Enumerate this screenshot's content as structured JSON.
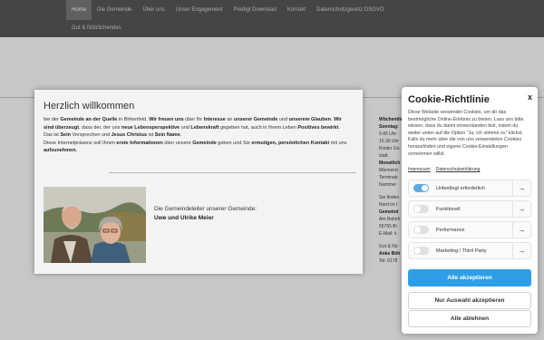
{
  "nav": {
    "items": [
      {
        "label": "Home",
        "active": true
      },
      {
        "label": "Die Gemeinde",
        "active": false
      },
      {
        "label": "Über uns",
        "active": false
      },
      {
        "label": "Unser Engagement",
        "active": false
      },
      {
        "label": "Predigt Download",
        "active": false
      },
      {
        "label": "Kontakt",
        "active": false
      },
      {
        "label": "Datenschutzgesetz DSGVO",
        "active": false
      }
    ],
    "row2_item": "Gut & Nützlichendes"
  },
  "sidebar": {
    "lines": [
      {
        "text": "Wöchentlich",
        "bold": true
      },
      {
        "text": "Sonntag:",
        "bold": true
      },
      {
        "text": "9.45 Uhr",
        "bold": false
      },
      {
        "text": "10.30 Uhr",
        "bold": false
      },
      {
        "text": "Kinder Go",
        "bold": false
      },
      {
        "text": "statt.",
        "bold": false
      },
      {
        "text": "Monatlich",
        "bold": true
      },
      {
        "text": "Männerst",
        "bold": false
      },
      {
        "text": "Terminab",
        "bold": false
      },
      {
        "text": "Nummer",
        "bold": false
      },
      {
        "text": "",
        "bold": false
      },
      {
        "text": "Sie finden",
        "bold": false
      },
      {
        "text": "Nord im I",
        "bold": false
      },
      {
        "text": "Gemeind",
        "bold": true
      },
      {
        "text": "Am Bahnh",
        "bold": false
      },
      {
        "text": "55765 Bi",
        "bold": false
      },
      {
        "text": "E-Mail: k",
        "bold": false
      },
      {
        "text": "",
        "bold": false
      },
      {
        "text": "Gut & Nü",
        "bold": false
      },
      {
        "text": "Anke Böh",
        "bold": true
      },
      {
        "text": "Tel: 0178",
        "bold": false
      }
    ]
  },
  "welcome": {
    "title": "Herzlich willkommen",
    "p1": [
      {
        "t": "bei der ",
        "b": false
      },
      {
        "t": "Gemeinde an der Quelle",
        "b": true
      },
      {
        "t": " in Birkenfeld. ",
        "b": false
      },
      {
        "t": "Wir freuen uns",
        "b": true
      },
      {
        "t": " über Ihr ",
        "b": false
      },
      {
        "t": "Interesse",
        "b": true
      },
      {
        "t": " an ",
        "b": false
      },
      {
        "t": "unserer Gemeinde",
        "b": true
      },
      {
        "t": " und ",
        "b": false
      },
      {
        "t": "unserem Glauben",
        "b": true
      },
      {
        "t": ". ",
        "b": false
      },
      {
        "t": "Wir sind überzeugt",
        "b": true
      },
      {
        "t": ", dass der, der uns ",
        "b": false
      },
      {
        "t": "neue Lebensperspektive",
        "b": true
      },
      {
        "t": " und ",
        "b": false
      },
      {
        "t": "Lebenskraft",
        "b": true
      },
      {
        "t": " gegeben hat, auch in Ihrem Leben ",
        "b": false
      },
      {
        "t": "Positives bewirkt",
        "b": true
      },
      {
        "t": ". Das ist ",
        "b": false
      },
      {
        "t": "Sein",
        "b": true
      },
      {
        "t": " Versprechen und ",
        "b": false
      },
      {
        "t": "Jesus Christus",
        "b": true
      },
      {
        "t": " ist ",
        "b": false
      },
      {
        "t": "Sein Name",
        "b": true
      },
      {
        "t": ".",
        "b": false
      }
    ],
    "p2": [
      {
        "t": "Diese Internetpräsenz soll Ihnen ",
        "b": false
      },
      {
        "t": "erste Informationen",
        "b": true
      },
      {
        "t": " über unsere ",
        "b": false
      },
      {
        "t": "Gemeinde",
        "b": true
      },
      {
        "t": " geben und Sie ",
        "b": false
      },
      {
        "t": "ermutigen, persönlichen Kontakt",
        "b": true
      },
      {
        "t": " mit uns ",
        "b": false
      },
      {
        "t": "aufzunehmen.",
        "b": true
      }
    ],
    "photo_icon": "couple-portrait-photo",
    "caption": "Die Gemeindeleiter unserer Gemeinde:",
    "names": "Uwe und Ulrike Meier"
  },
  "cookie": {
    "title": "Cookie-Richtlinie",
    "close": "x",
    "text": "Diese Website verwendet Cookies, um dir das bestmögliche Online-Erlebnis zu bieten. Lass uns bitte wissen, dass du damit einverstanden bist, indem du weiter unten auf die Option \"Ja, ich stimme zu\" klickst. Falls du mehr über die von uns verwendeten Cookies herausfinden und eigene Cookie-Einstellungen vornehmen willst.",
    "links": {
      "imprint": "Impressum",
      "privacy": "Datenschutzerklärung"
    },
    "categories": [
      {
        "label": "Unbedingt erforderlich",
        "on": true
      },
      {
        "label": "Funktionell",
        "on": false
      },
      {
        "label": "Performance",
        "on": false
      },
      {
        "label": "Marketing / Third Party",
        "on": false
      }
    ],
    "arrow": "→",
    "buttons": {
      "accept_all": "Alle akzeptieren",
      "accept_selection": "Nur Auswahl akzeptieren",
      "reject_all": "Alle ablehnen"
    }
  }
}
